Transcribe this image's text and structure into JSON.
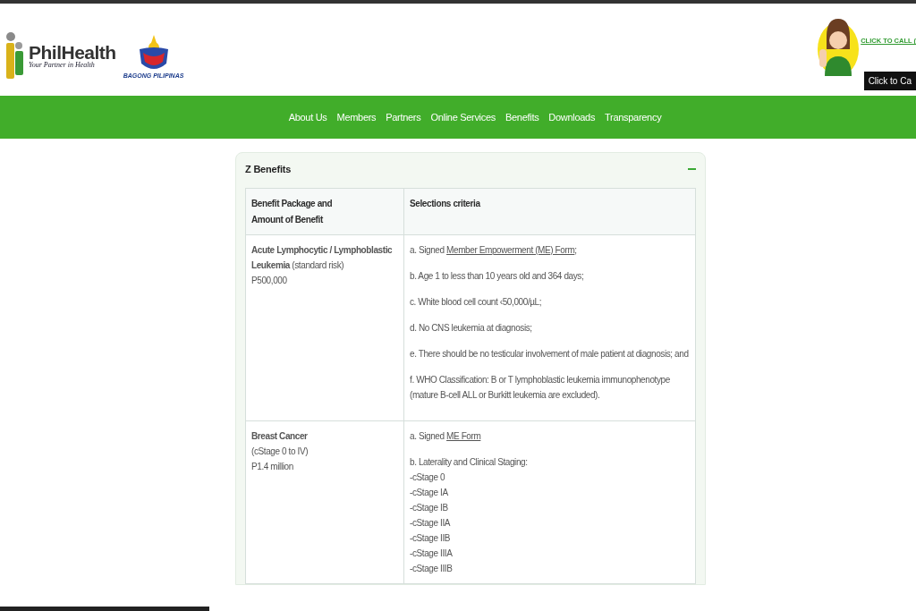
{
  "header": {
    "logo_name": "PhilHealth",
    "logo_tagline": "Your Partner in Health",
    "emblem_caption": "BAGONG PILIPINAS",
    "call_link": "CLICK TO CALL (",
    "call_tooltip": "Click to Ca"
  },
  "nav": [
    "About Us",
    "Members",
    "Partners",
    "Online Services",
    "Benefits",
    "Downloads",
    "Transparency"
  ],
  "panel": {
    "title": "Z Benefits",
    "expanded": true,
    "table": {
      "columns": [
        {
          "lines": [
            "Benefit Package and",
            "Amount of Benefit"
          ]
        },
        {
          "lines": [
            "Selections criteria"
          ]
        }
      ],
      "rows": [
        {
          "package": [
            "**Acute Lymphocytic / Lymphoblastic Leukemia** (standard risk)",
            "P500,000"
          ],
          "criteria": [
            {
              "text": "a. Signed ",
              "link": "Member Empowerment (ME) Form",
              "after": ";"
            },
            {
              "text": "b. Age 1 to less than 10 years old and 364 days;"
            },
            {
              "text": "c. White blood cell count ‹50,000/µL;"
            },
            {
              "text": "d. No CNS leukemia at diagnosis;"
            },
            {
              "text": "e. There should be no testicular involvement of male patient at diagnosis; and"
            },
            {
              "text": "f. WHO Classification: B or T lymphoblastic leukemia immunophenotype (mature B-cell ALL or Burkitt leukemia are excluded)."
            }
          ]
        },
        {
          "package": [
            "**Breast Cancer**",
            "(cStage 0 to IV)",
            "P1.4 million"
          ],
          "criteria": [
            {
              "text": "a. Signed ",
              "link": "ME Form"
            },
            {
              "text": "b. Laterality and Clinical Staging:",
              "sublines": [
                "-cStage 0",
                "-cStage IA",
                "-cStage IB",
                "-cStage IIA",
                "-cStage IIB",
                "-cStage IIIA",
                "-cStage IIIB"
              ]
            }
          ]
        }
      ]
    }
  }
}
